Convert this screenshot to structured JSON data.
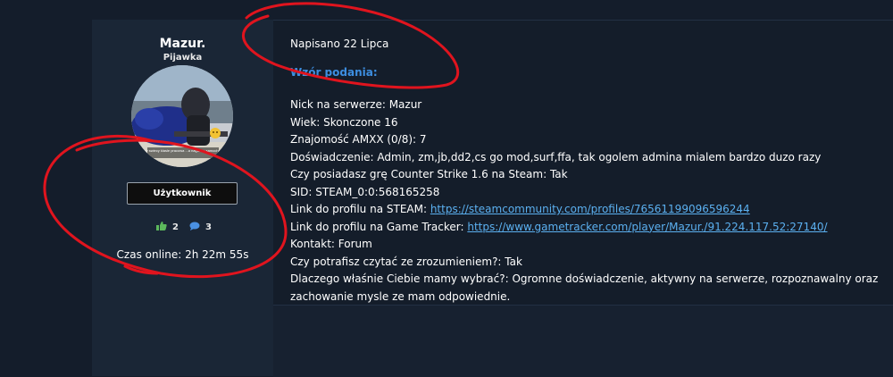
{
  "author": {
    "name": "Mazur.",
    "rank": "Pijawka",
    "avatar_caption": "...rady swiecy klasie pracowa ...a nagle na samochod ...",
    "group": "Użytkownik",
    "likes": "2",
    "posts": "3",
    "online_time": "Czas online: 2h 22m 55s"
  },
  "post": {
    "meta": "Napisano 22 Lipca",
    "heading": "Wzór podania:",
    "lines": [
      {
        "label": "Nick na serwerze: ",
        "value": "Mazur"
      },
      {
        "label": "Wiek: ",
        "value": "Skonczone 16"
      },
      {
        "label": "Znajomość AMXX (0/8): ",
        "value": "7"
      },
      {
        "label": "Doświadczenie: ",
        "value": "Admin, zm,jb,dd2,cs go mod,surf,ffa, tak ogolem admina mialem bardzo duzo razy"
      },
      {
        "label": "Czy posiadasz grę Counter Strike 1.6 na Steam: ",
        "value": "Tak"
      },
      {
        "label": "SID: ",
        "value": "STEAM_0:0:568165258"
      },
      {
        "label": "Link do profilu na STEAM: ",
        "link": "https://steamcommunity.com/profiles/76561199096596244"
      },
      {
        "label": "Link do profilu na Game Tracker: ",
        "link": "https://www.gametracker.com/player/Mazur./91.224.117.52:27140/"
      },
      {
        "label": "Kontakt: ",
        "value": "Forum"
      },
      {
        "label": "Czy potrafisz czytać ze zrozumieniem?: ",
        "value": " Tak"
      },
      {
        "label": "Dlaczego właśnie Ciebie mamy wybrać?: ",
        "value": "Ogromne doświadczenie, aktywny na serwerze, rozpoznawalny oraz"
      },
      {
        "label": "",
        "value": "zachowanie mysle ze mam odpowiednie."
      }
    ]
  },
  "colors": {
    "background": "#141d2b",
    "heading_accent": "#3d8ee0",
    "link": "#5bb0f0",
    "annotation_red": "#e0141e",
    "like_green": "#5cb85c",
    "posts_blue": "#4a90e2"
  }
}
